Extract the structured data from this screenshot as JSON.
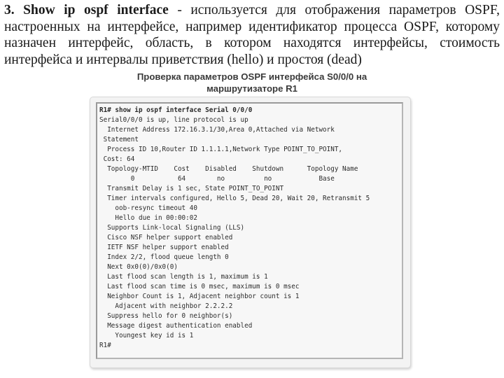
{
  "intro": {
    "number": "3.",
    "command": "Show ip ospf interface",
    "separator": " - ",
    "description": "используется для отображения параметров OSPF, настроенных на интерфейсе, например идентификатор процесса OSPF, которому назначен интерфейс, область, в котором находятся интерфейсы, стоимость интерфейса и интервалы приветствия (hello) и простоя (dead)"
  },
  "figure": {
    "caption_line1": "Проверка параметров OSPF интерфейса S0/0/0 на",
    "caption_line2": "маршрутизаторе R1"
  },
  "terminal": {
    "lines": [
      "R1# show ip ospf interface Serial 0/0/0",
      "Serial0/0/0 is up, line protocol is up",
      "  Internet Address 172.16.3.1/30,Area 0,Attached via Network",
      " Statement",
      "  Process ID 10,Router ID 1.1.1.1,Network Type POINT_TO_POINT,",
      " Cost: 64",
      "  Topology-MTID    Cost    Disabled    Shutdown      Topology Name",
      "        0           64        no          no            Base",
      "  Transmit Delay is 1 sec, State POINT_TO_POINT",
      "  Timer intervals configured, Hello 5, Dead 20, Wait 20, Retransmit 5",
      "    oob-resync timeout 40",
      "    Hello due in 00:00:02",
      "  Supports Link-local Signaling (LLS)",
      "  Cisco NSF helper support enabled",
      "  IETF NSF helper support enabled",
      "  Index 2/2, flood queue length 0",
      "  Next 0x0(0)/0x0(0)",
      "  Last flood scan length is 1, maximum is 1",
      "  Last flood scan time is 0 msec, maximum is 0 msec",
      "  Neighbor Count is 1, Adjacent neighbor count is 1",
      "    Adjacent with neighbor 2.2.2.2",
      "  Suppress hello for 0 neighbor(s)",
      "  Message digest authentication enabled",
      "    Youngest key id is 1",
      "R1#"
    ]
  }
}
